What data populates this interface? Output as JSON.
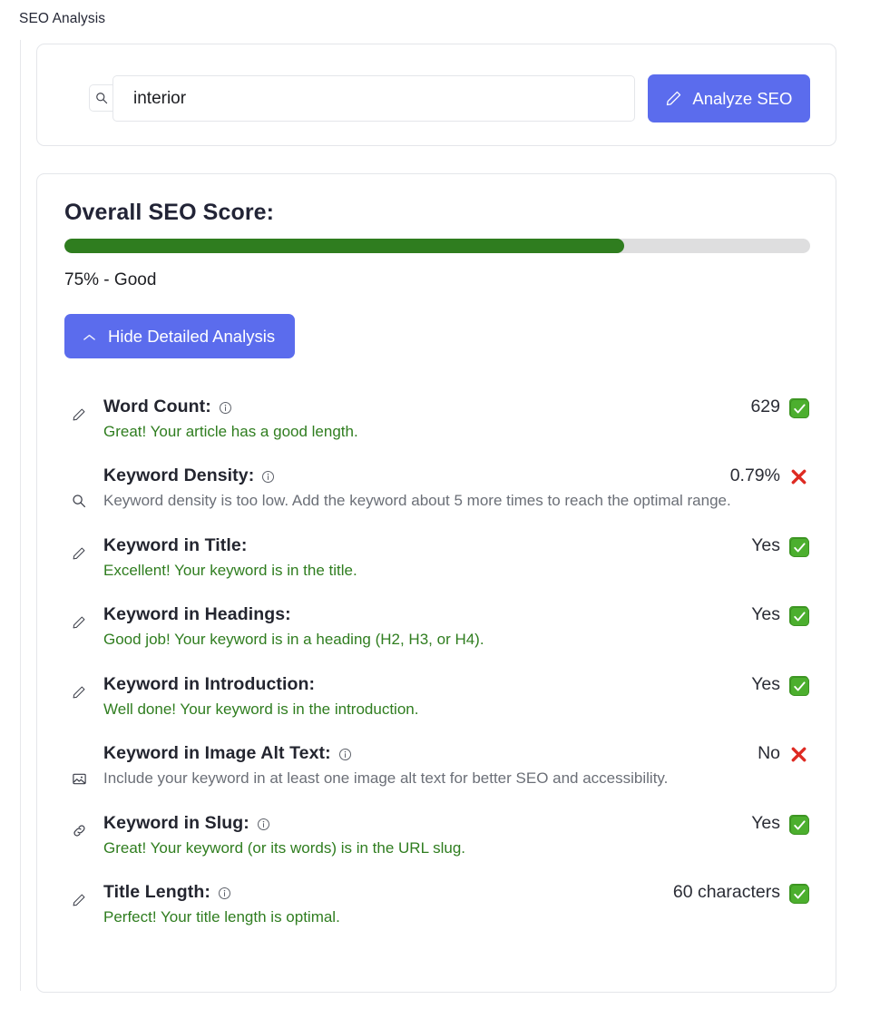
{
  "page": {
    "title": "SEO Analysis"
  },
  "search": {
    "icon": "search-icon",
    "value": "interior",
    "placeholder": "interior",
    "button_label": "Analyze SEO",
    "button_icon": "pencil-icon",
    "accent_color": "#5b6ced"
  },
  "score": {
    "heading": "Overall SEO Score:",
    "percent": 75,
    "caption": "75% - Good",
    "bar_fill_color": "#2f7d1f",
    "bar_track_color": "#dededf",
    "toggle_label": "Hide Detailed Analysis",
    "toggle_icon": "chevron-up-icon"
  },
  "analysis": {
    "items": [
      {
        "icon": "pencil-icon",
        "label": "Word Count:",
        "has_info_icon": true,
        "value": "629",
        "status": "pass",
        "status_icon": "check-mark-button",
        "description": "Great! Your article has a good length.",
        "description_tone": "good"
      },
      {
        "icon": "search-icon",
        "label": "Keyword Density:",
        "has_info_icon": true,
        "value": "0.79%",
        "status": "fail",
        "status_icon": "cross-mark",
        "description": "Keyword density is too low. Add the keyword about 5 more times to reach the optimal range.",
        "description_tone": "bad"
      },
      {
        "icon": "pencil-icon",
        "label": "Keyword in Title:",
        "has_info_icon": false,
        "value": "Yes",
        "status": "pass",
        "status_icon": "check-mark-button",
        "description": "Excellent! Your keyword is in the title.",
        "description_tone": "good"
      },
      {
        "icon": "pencil-icon",
        "label": "Keyword in Headings:",
        "has_info_icon": false,
        "value": "Yes",
        "status": "pass",
        "status_icon": "check-mark-button",
        "description": "Good job! Your keyword is in a heading (H2, H3, or H4).",
        "description_tone": "good"
      },
      {
        "icon": "pencil-icon",
        "label": "Keyword in Introduction:",
        "has_info_icon": false,
        "value": "Yes",
        "status": "pass",
        "status_icon": "check-mark-button",
        "description": "Well done! Your keyword is in the introduction.",
        "description_tone": "good"
      },
      {
        "icon": "image-icon",
        "label": "Keyword in Image Alt Text:",
        "has_info_icon": true,
        "value": "No",
        "status": "fail",
        "status_icon": "cross-mark",
        "description": "Include your keyword in at least one image alt text for better SEO and accessibility.",
        "description_tone": "bad"
      },
      {
        "icon": "link-icon",
        "label": "Keyword in Slug:",
        "has_info_icon": true,
        "value": "Yes",
        "status": "pass",
        "status_icon": "check-mark-button",
        "description": "Great! Your keyword (or its words) is in the URL slug.",
        "description_tone": "good"
      },
      {
        "icon": "pencil-icon",
        "label": "Title Length:",
        "has_info_icon": true,
        "value": "60 characters",
        "status": "pass",
        "status_icon": "check-mark-button",
        "description": "Perfect! Your title length is optimal.",
        "description_tone": "good"
      }
    ]
  }
}
